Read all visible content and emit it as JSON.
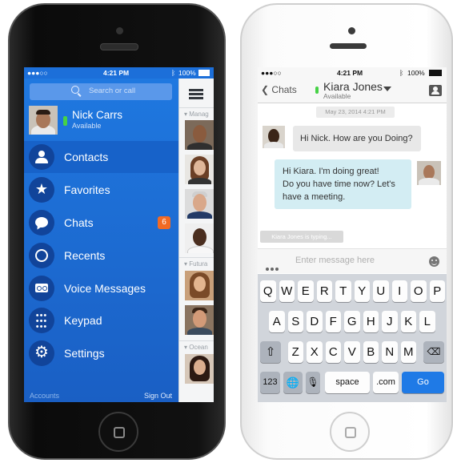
{
  "left_phone": {
    "status": {
      "carrier": "●●●○○",
      "time": "4:21 PM",
      "battery": "100%"
    },
    "search": {
      "placeholder": "Search or call"
    },
    "profile": {
      "name": "Nick Carrs",
      "status": "Available"
    },
    "menu": [
      {
        "label": "Contacts",
        "icon": "person-icon",
        "active": true
      },
      {
        "label": "Favorites",
        "icon": "star-icon"
      },
      {
        "label": "Chats",
        "icon": "chat-bubble-icon",
        "badge": "6"
      },
      {
        "label": "Recents",
        "icon": "clock-icon"
      },
      {
        "label": "Voice Messages",
        "icon": "voicemail-icon"
      },
      {
        "label": "Keypad",
        "icon": "keypad-icon"
      },
      {
        "label": "Settings",
        "icon": "gear-icon"
      }
    ],
    "footer": {
      "accounts": "Accounts",
      "sign_out": "Sign Out"
    },
    "list_sections": [
      "Manag",
      "Futura",
      "Ocean"
    ]
  },
  "right_phone": {
    "status": {
      "carrier": "●●●○○",
      "time": "4:21 PM",
      "battery": "100%"
    },
    "nav": {
      "back": "Chats",
      "contact_name": "Kiara Jones",
      "contact_status": "Available"
    },
    "date": "May 23, 2014 4:21 PM",
    "messages": [
      {
        "direction": "in",
        "text": "Hi Nick. How are you Doing?"
      },
      {
        "direction": "out",
        "lines": [
          "Hi Kiara. I'm doing great!",
          "Do you have time now? Let's",
          "have a meeting."
        ]
      }
    ],
    "typing": "Kiara Jones is typing...",
    "input": {
      "placeholder": "Enter message here"
    },
    "keyboard": {
      "row1": [
        "Q",
        "W",
        "E",
        "R",
        "T",
        "Y",
        "U",
        "I",
        "O",
        "P"
      ],
      "row2": [
        "A",
        "S",
        "D",
        "F",
        "G",
        "H",
        "J",
        "K",
        "L"
      ],
      "row3": [
        "Z",
        "X",
        "C",
        "V",
        "B",
        "N",
        "M"
      ],
      "bottom": {
        "numbers": "123",
        "space": "space",
        "dotcom": ".com",
        "go": "Go"
      }
    }
  },
  "colors": {
    "accent_blue": "#1b6fd8",
    "badge_orange": "#f26a24",
    "presence_green": "#46d246",
    "go_blue": "#1f7ae6"
  }
}
